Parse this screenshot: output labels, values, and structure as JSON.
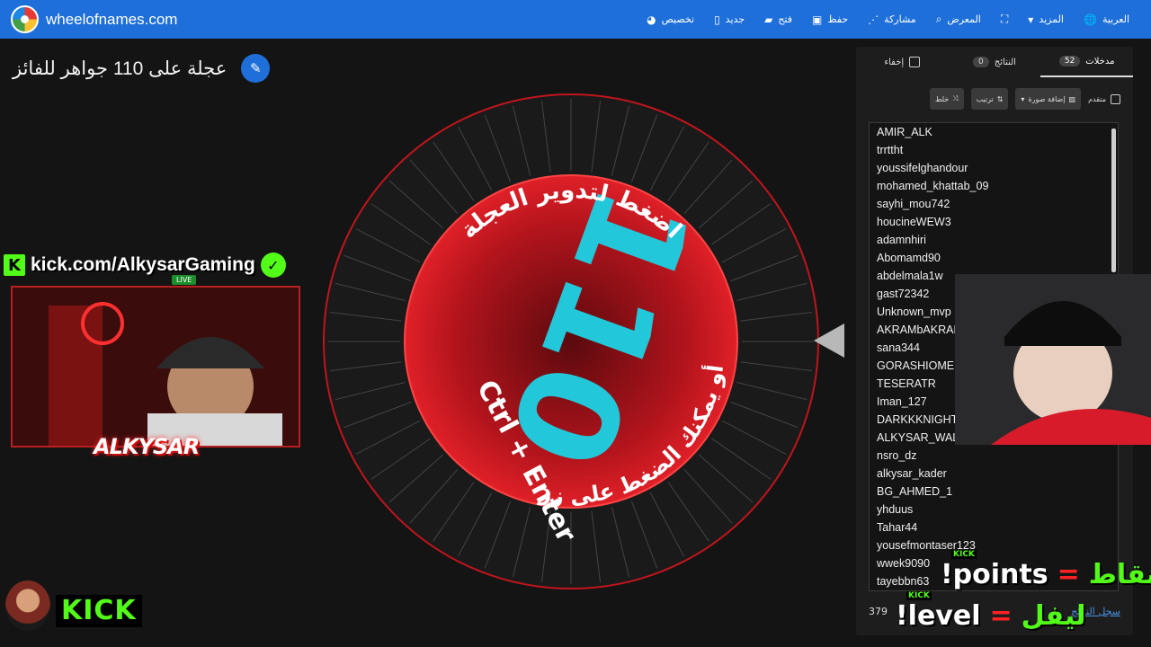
{
  "site": {
    "name": "wheelofnames.com"
  },
  "nav": [
    {
      "label": "العربية",
      "icon": "globe-icon"
    },
    {
      "label": "المزيد",
      "icon": "caret-down-icon"
    },
    {
      "label": "",
      "icon": "fullscreen-icon"
    },
    {
      "label": "المعرض",
      "icon": "search-icon"
    },
    {
      "label": "مشاركة",
      "icon": "share-icon"
    },
    {
      "label": "حفظ",
      "icon": "save-icon"
    },
    {
      "label": "فتح",
      "icon": "folder-icon"
    },
    {
      "label": "جديد",
      "icon": "file-icon"
    },
    {
      "label": "تخصيص",
      "icon": "palette-icon"
    }
  ],
  "page": {
    "title": "عجلة على 110 جواهر للفائز"
  },
  "wheel": {
    "center_text": "110",
    "instruction_top": "اضغط لتدوير العجلة",
    "instruction_bottom": "أو يمكنك الضغط على زر",
    "shortcut": "Ctrl + Enter",
    "colors": {
      "ring": "#1a1a1a",
      "center": "#b3141c",
      "accent": "#22c7d9"
    }
  },
  "panel": {
    "tabs": {
      "entries_label": "مدخلات",
      "entries_count": "52",
      "results_label": "النتائج",
      "results_count": "0",
      "hide_label": "إخفاء"
    },
    "toolbar": {
      "shuffle": "خلط",
      "sort": "ترتيب",
      "add_image": "إضافة صورة",
      "advanced": "متقدم"
    },
    "entries": [
      "AMIR_ALK",
      "trrttht",
      "youssifelghandour",
      "mohamed_khattab_09",
      "sayhi_mou742",
      "houcineWEW3",
      "adamnhiri",
      "Abomamd90",
      "abdelmala1w",
      "gast72342",
      "Unknown_mvp",
      "AKRAMbAKRAM",
      "sana344",
      "GORASHIOMER",
      "TESERATR",
      "Iman_127",
      "DARKKKNIGHT",
      "ALKYSAR_WALID",
      "nsro_dz",
      "alkysar_kader",
      "BG_AHMED_1",
      "yhduus",
      "Tahar44",
      "yousefmontaser123",
      "wwek9090",
      "tayebbn63"
    ],
    "footer": {
      "count": "379",
      "link": "سجل النتائج"
    }
  },
  "overlays": {
    "kick_url": "kick.com/AlkysarGaming",
    "live": "LIVE",
    "streamer_name": "ALKYSAR",
    "kick_logo": "KICK",
    "points_ar": "نقاط",
    "points_en": "!points",
    "level_ar": "ليفل",
    "level_en": "!level",
    "kick_small": "KICK"
  }
}
